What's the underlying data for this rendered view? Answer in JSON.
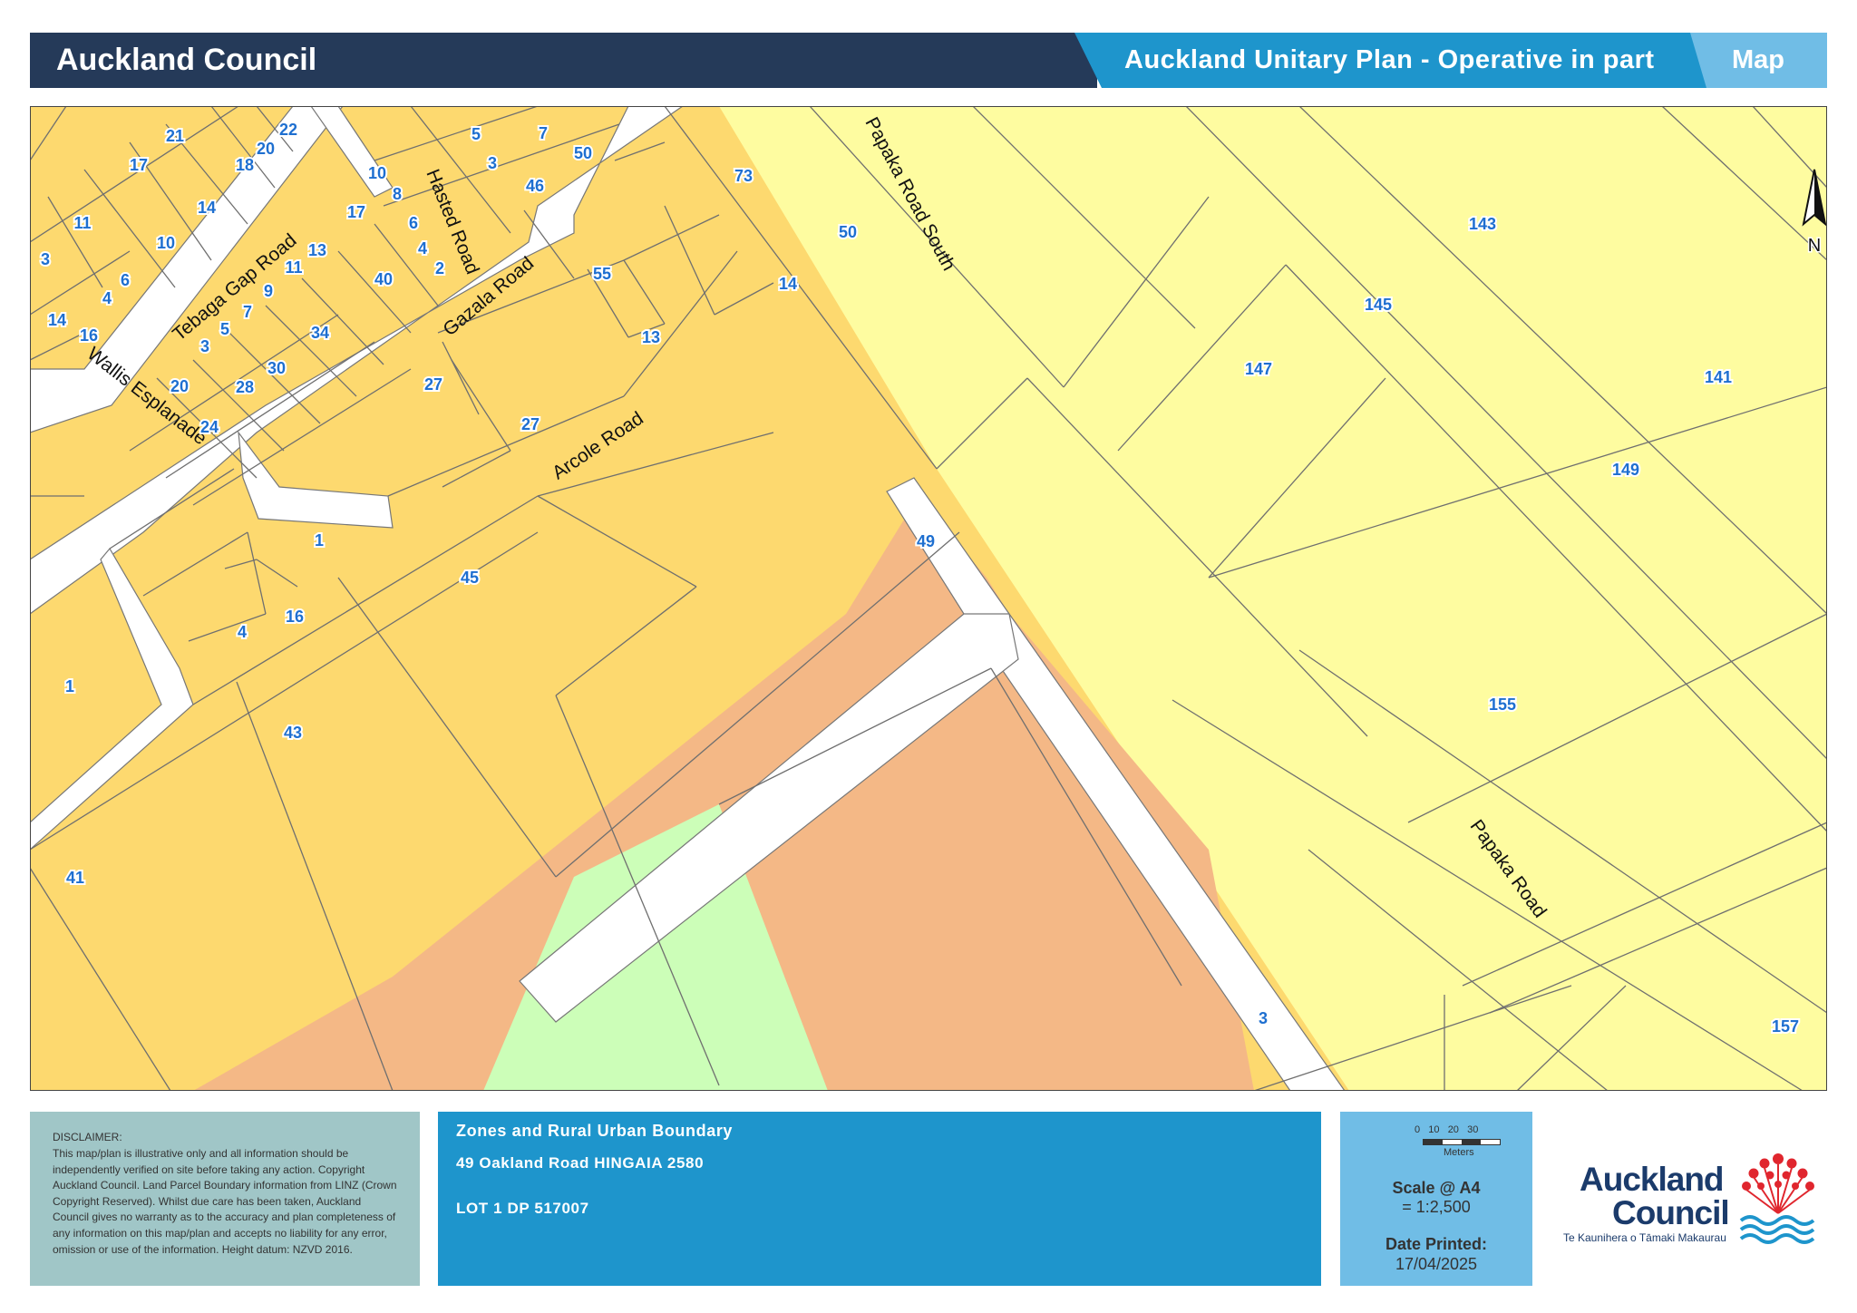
{
  "header": {
    "council_name": "Auckland Council",
    "plan_title": "Auckland Unitary Plan - Operative in part",
    "map_label": "Map"
  },
  "map": {
    "north_arrow_label": "N",
    "colors": {
      "residential_orange": "#fdd96f",
      "yellow_zone": "#fefca0",
      "salmon_zone": "#f4b886",
      "green_zone": "#ccfeb8",
      "road": "#ffffff",
      "lot_label": "#1e6fd0"
    },
    "street_names": [
      "Tebaga Gap Road",
      "Hasted Road",
      "Gazala Road",
      "Wallis Esplanade",
      "Arcole Road",
      "Papaka Road South",
      "Papaka Road"
    ],
    "lot_numbers": [
      "21",
      "22",
      "20",
      "17",
      "18",
      "14",
      "10",
      "11",
      "3",
      "6",
      "4",
      "14",
      "16",
      "9",
      "5",
      "7",
      "3",
      "13",
      "11",
      "17",
      "8",
      "6",
      "10",
      "4",
      "2",
      "40",
      "34",
      "30",
      "28",
      "20",
      "24",
      "5",
      "7",
      "3",
      "50",
      "46",
      "73",
      "55",
      "50",
      "14",
      "13",
      "27",
      "27",
      "1",
      "45",
      "4",
      "16",
      "1",
      "43",
      "41",
      "49",
      "147",
      "143",
      "145",
      "141",
      "149",
      "155",
      "157",
      "3"
    ]
  },
  "footer": {
    "disclaimer_head": "DISCLAIMER:",
    "disclaimer_body": "This map/plan is illustrative only and all information should be independently verified on site before taking any action. Copyright Auckland Council. Land Parcel Boundary information from LINZ (Crown Copyright Reserved). Whilst due care has been taken, Auckland Council gives no warranty as to the accuracy and plan completeness of any information on this map/plan and accepts no liability for any error, omission or use of the information. Height datum: NZVD 2016.",
    "zone_title": "Zones and Rural Urban Boundary",
    "address": "49 Oakland Road HINGAIA 2580",
    "lot": "LOT 1 DP 517007",
    "scale_ticks": "0   10   20   30",
    "scale_units": "Meters",
    "scale_label": "Scale @ A4",
    "scale_value": "= 1:2,500",
    "date_label": "Date Printed:",
    "date_value": "17/04/2025",
    "logo_line1": "Auckland",
    "logo_line2": "Council",
    "logo_sub": "Te Kaunihera o Tāmaki Makaurau"
  }
}
